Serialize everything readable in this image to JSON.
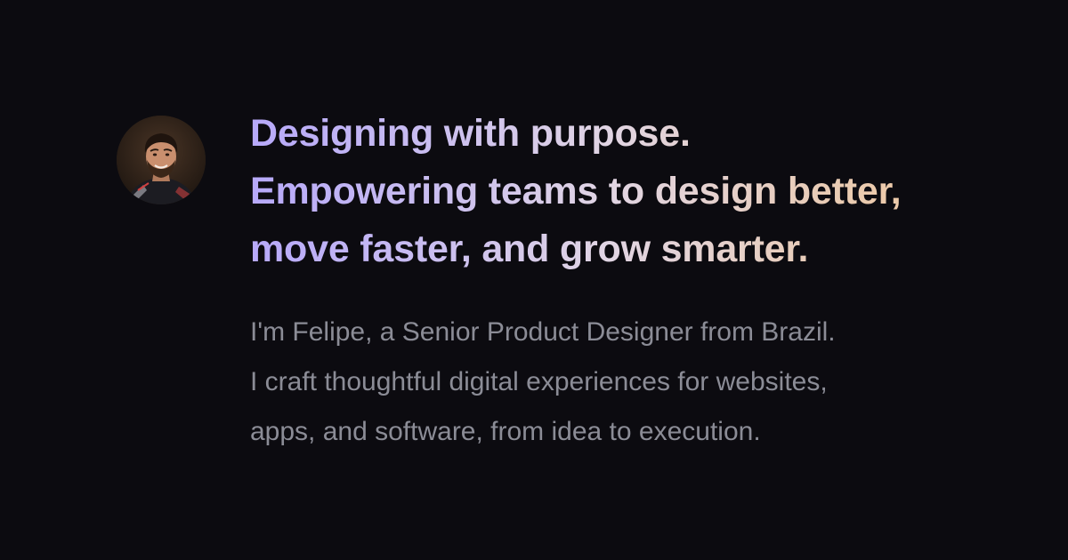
{
  "avatar": {
    "icon": "profile-photo",
    "background": "#2a1f18"
  },
  "headline": {
    "lines": [
      "Designing with purpose.",
      "Empowering teams to design better,",
      "move faster, and grow smarter."
    ],
    "gradient_colors": [
      "#b7a9fa",
      "#e1d5e4",
      "#f0c7a0"
    ]
  },
  "intro": {
    "lines": [
      "I'm Felipe, a Senior Product Designer from Brazil.",
      "I craft thoughtful digital experiences for websites,",
      "apps, and software, from idea to execution."
    ],
    "color": "#8b8c96"
  },
  "background_color": "#0c0b10"
}
